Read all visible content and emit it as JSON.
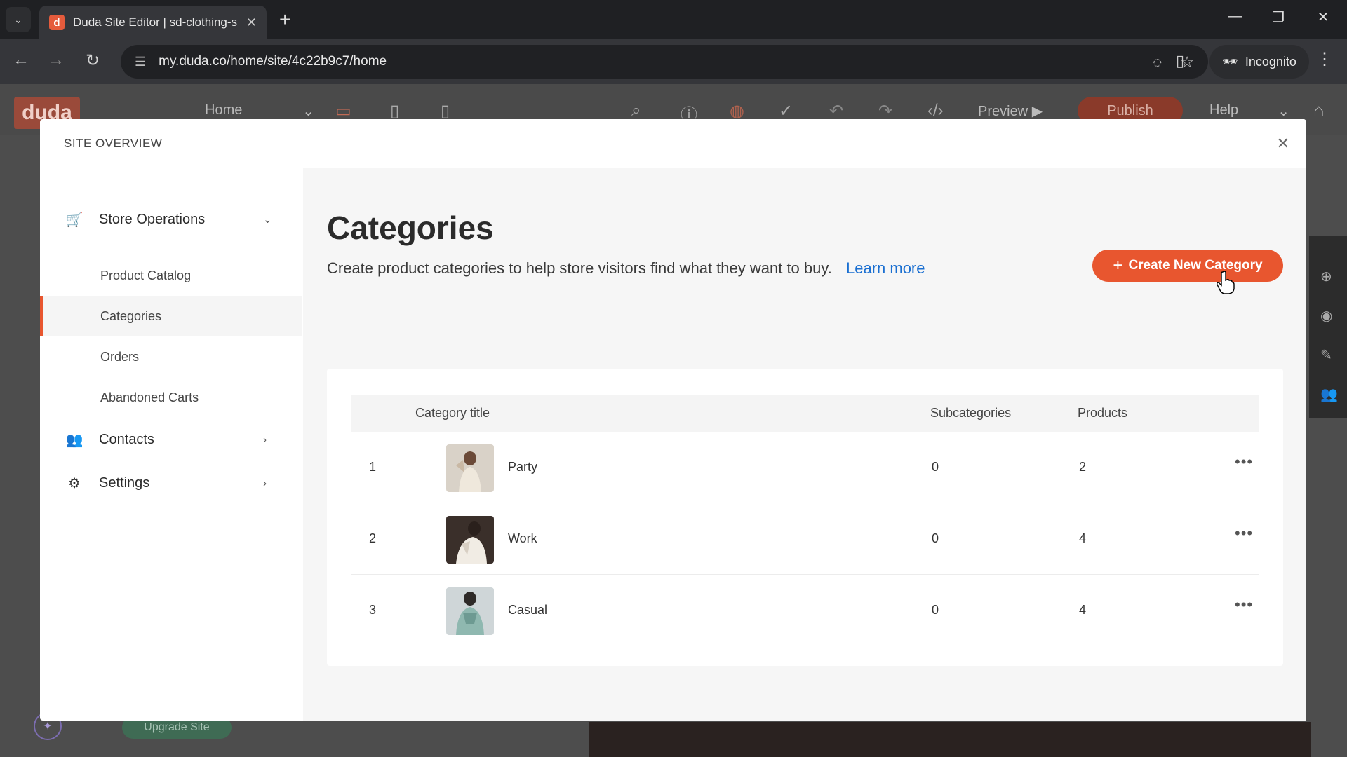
{
  "browser": {
    "tab_title": "Duda Site Editor | sd-clothing-s",
    "favicon_letter": "d",
    "url": "my.duda.co/home/site/4c22b9c7/home",
    "incognito_label": "Incognito"
  },
  "editor": {
    "logo": "duda",
    "page_select": "Home",
    "preview_label": "Preview",
    "publish_label": "Publish",
    "help_label": "Help",
    "upgrade_label": "Upgrade Site"
  },
  "modal": {
    "header": "SITE OVERVIEW",
    "sidebar": {
      "store_operations": "Store Operations",
      "sub_items": [
        "Product Catalog",
        "Categories",
        "Orders",
        "Abandoned Carts"
      ],
      "contacts": "Contacts",
      "settings": "Settings"
    },
    "content": {
      "title": "Categories",
      "description": "Create product categories to help store visitors find what they want to buy.",
      "learn_more": "Learn more",
      "create_button": "Create New Category",
      "table": {
        "headers": [
          "Category title",
          "Subcategories",
          "Products"
        ],
        "rows": [
          {
            "index": "1",
            "title": "Party",
            "subcategories": "0",
            "products": "2"
          },
          {
            "index": "2",
            "title": "Work",
            "subcategories": "0",
            "products": "4"
          },
          {
            "index": "3",
            "title": "Casual",
            "subcategories": "0",
            "products": "4"
          }
        ]
      }
    }
  },
  "colors": {
    "accent": "#e8562f",
    "link": "#1a6fd1"
  }
}
